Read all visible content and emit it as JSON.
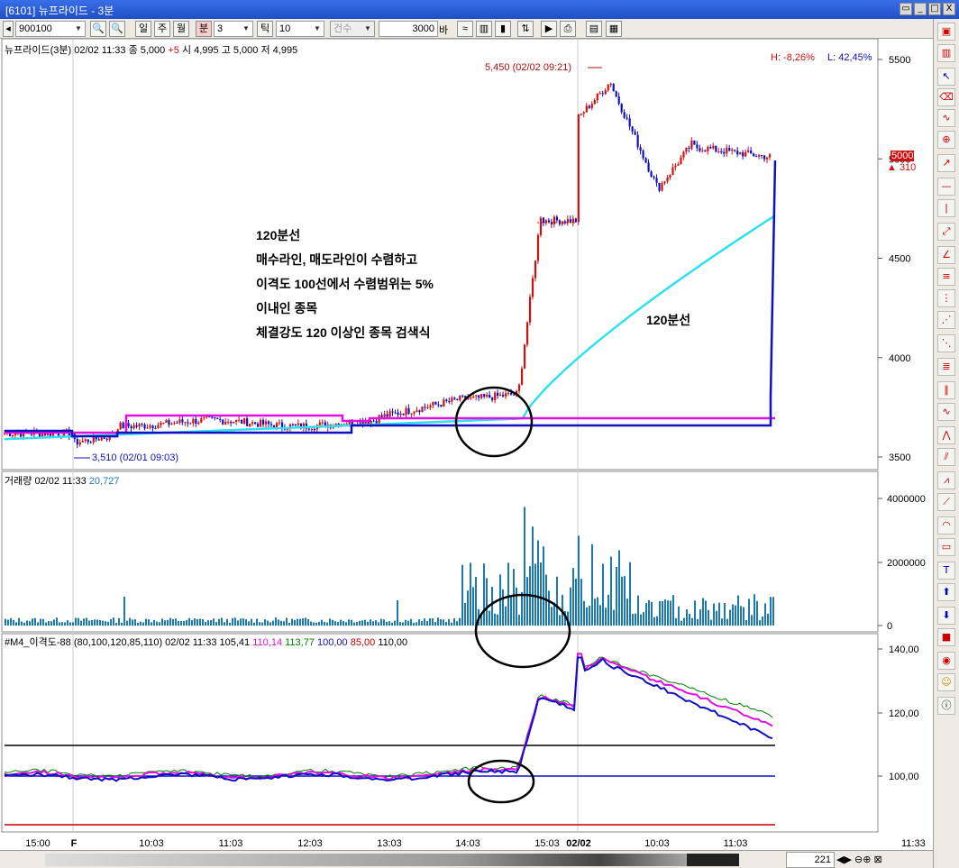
{
  "window": {
    "title": "[6101] 뉴프라이드 - 3분",
    "buttons": [
      "▭",
      "_",
      "□",
      "X"
    ]
  },
  "toolbar": {
    "code": "900100",
    "periods": [
      "일",
      "주",
      "월",
      "분"
    ],
    "active_period": "분",
    "minute_value": "3",
    "tick_label": "틱",
    "tick_value": "10",
    "count_label": "건수",
    "bars_value": "3000",
    "bars_unit": "바"
  },
  "price_panel": {
    "header": "뉴프라이드(3분) 02/02 11:33  종 5,000",
    "header_change": "+5",
    "header_rest": "  시 4,995  고 5,000  저 4,995",
    "high_label": "H: -8,26%",
    "low_label": "L: 42,45%",
    "high_marker": "5,450 (02/02 09:21)",
    "low_marker": "3,510 (02/01 09:03)",
    "current_price": "5000",
    "current_change": "▲ 310",
    "y_ticks": [
      "5500",
      "5000",
      "4500",
      "4000",
      "3500"
    ]
  },
  "annotations": {
    "lines": [
      "120분선",
      "매수라인, 매도라인이 수렴하고",
      "이격도 100선에서 수렴범위는 5%",
      "이내인 종목",
      "체결강도 120 이상인 종목 검색식"
    ],
    "ma_label": "120분선"
  },
  "volume_panel": {
    "label": "거래량",
    "stamp": "02/02 11:33",
    "value": "20,727",
    "y_ticks": [
      "4000000",
      "2000000",
      "0"
    ]
  },
  "osc_panel": {
    "label": "#M4_이격도-88",
    "params": "(80,100,120,85,110) 02/02 11:33 105,41",
    "v1": "110,14",
    "v2": "113,77",
    "v3": "100,00",
    "v4": "85,00",
    "v5": "110,00",
    "y_ticks": [
      "140,00",
      "120,00",
      "100,00"
    ]
  },
  "x_axis": {
    "ticks": [
      "15:00",
      "F",
      "10:03",
      "11:03",
      "12:03",
      "13:03",
      "14:03",
      "15:03",
      "02/02",
      "10:03",
      "11:03"
    ],
    "time": "11:33"
  },
  "bottom": {
    "scroll_count": "221"
  },
  "colors": {
    "up": "#d01010",
    "down": "#1010c0",
    "ma120": "#30e0f0",
    "buyline": "#e010e0",
    "sellline": "#1010c0",
    "volume": "#1a78b4",
    "osc_green": "#008000"
  }
}
